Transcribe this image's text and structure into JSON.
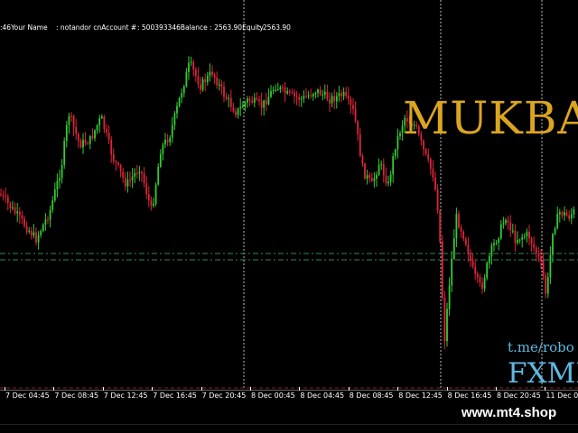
{
  "account_info": {
    "name_field": ":46Your Name",
    "login_field": ": notandor cnAccount #",
    "balance_field": ": 500393346Balance : 2563.90Equity",
    "equity_field": ": 2563.90"
  },
  "branding": {
    "title": "MUKBA",
    "link": "t.me/robo",
    "subtitle": "FXMI"
  },
  "time_axis": {
    "labels": [
      "7 Dec 04:45",
      "7 Dec 08:45",
      "7 Dec 12:45",
      "7 Dec 16:45",
      "7 Dec 20:45",
      "8 Dec 00:45",
      "8 Dec 04:45",
      "8 Dec 08:45",
      "8 Dec 12:45",
      "8 Dec 16:45",
      "8 Dec 20:45",
      "11 Dec 0"
    ]
  },
  "watermark": {
    "text": "www.mt4.shop"
  },
  "colors": {
    "background": "#000000",
    "bull_candle": "#33cc33",
    "bear_candle": "#e0243a",
    "brand_gold": "#daa520",
    "brand_blue": "#5fb8e0",
    "level_line": "#2e8b57"
  }
}
